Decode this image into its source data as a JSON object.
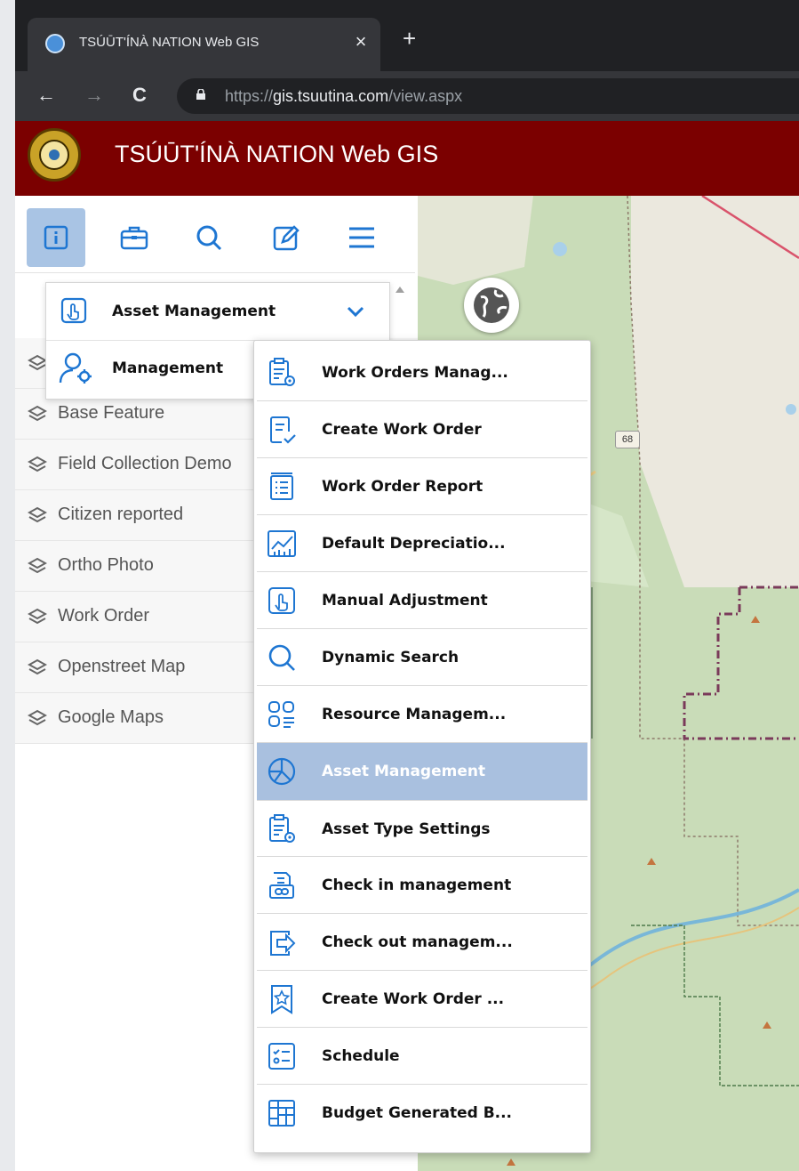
{
  "browser": {
    "tab_title": "TSÚŪT'ÍNÀ NATION Web GIS",
    "close_glyph": "×",
    "newtab_glyph": "+",
    "back_glyph": "←",
    "forward_glyph": "→",
    "reload_glyph": "C",
    "url_scheme": "https://",
    "url_host": "gis.tsuutina.com",
    "url_path": "/view.aspx"
  },
  "app": {
    "title": "TSÚŪT'ÍNÀ NATION Web GIS"
  },
  "toolbar": {
    "icons": [
      "info-icon",
      "briefcase-icon",
      "search-icon",
      "edit-icon",
      "menu-icon"
    ]
  },
  "dropdown": {
    "selected": "Asset Management",
    "second": "Management"
  },
  "layers": [
    {
      "label": "Base Feature"
    },
    {
      "label": "Field Collection Demo"
    },
    {
      "label": "Citizen reported"
    },
    {
      "label": "Ortho Photo"
    },
    {
      "label": "Work Order"
    },
    {
      "label": "Openstreet Map"
    },
    {
      "label": "Google Maps"
    }
  ],
  "map": {
    "road_label": "68"
  },
  "submenu": {
    "items": [
      {
        "label": "Work Orders Manag...",
        "icon": "clipboard-gear-icon"
      },
      {
        "label": "Create Work Order",
        "icon": "document-check-icon"
      },
      {
        "label": "Work Order Report",
        "icon": "list-report-icon"
      },
      {
        "label": "Default Depreciatio...",
        "icon": "chart-icon"
      },
      {
        "label": "Manual Adjustment",
        "icon": "hand-pointer-icon"
      },
      {
        "label": "Dynamic Search",
        "icon": "search-icon"
      },
      {
        "label": "Resource Managem...",
        "icon": "grid-icon"
      },
      {
        "label": "Asset Management",
        "icon": "pie-chart-icon"
      },
      {
        "label": "Asset Type Settings",
        "icon": "clipboard-gear-icon"
      },
      {
        "label": "Check in management",
        "icon": "check-in-icon"
      },
      {
        "label": "Check out managem...",
        "icon": "check-out-icon"
      },
      {
        "label": "Create Work Order ...",
        "icon": "star-document-icon"
      },
      {
        "label": "Schedule",
        "icon": "schedule-list-icon"
      },
      {
        "label": "Budget Generated B...",
        "icon": "table-icon"
      }
    ],
    "highlighted_index": 7
  },
  "colors": {
    "header": "#7b0000",
    "accent": "#1e76d2",
    "highlight": "#a9c0df"
  }
}
